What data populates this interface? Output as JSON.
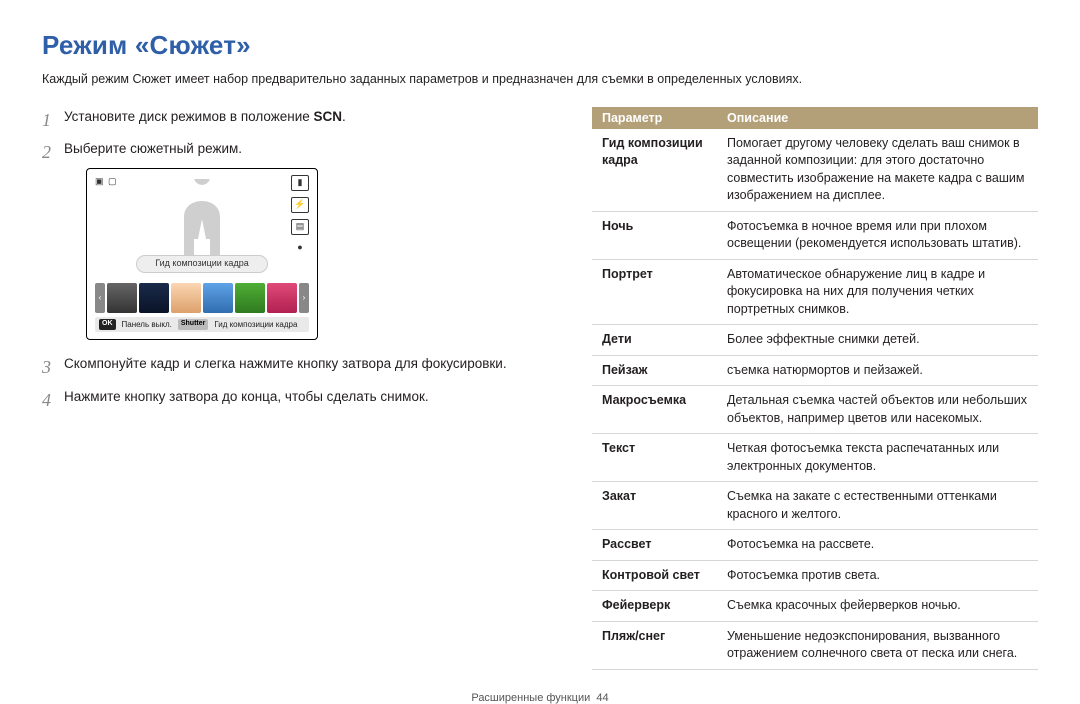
{
  "title": "Режим «Сюжет»",
  "lead": "Каждый режим Сюжет имеет набор предварительно заданных параметров и предназначен для съемки в определенных условиях.",
  "steps": {
    "s1_pre": "Установите диск режимов в положение ",
    "s1_icon": "SCN",
    "s1_post": ".",
    "s2": "Выберите сюжетный режим.",
    "s3": "Скомпонуйте кадр и слегка нажмите кнопку затвора для фокусировки.",
    "s4": "Нажмите кнопку затвора до конца, чтобы сделать снимок."
  },
  "screen": {
    "mid_label": "Гид композиции кадра",
    "ok_chip": "OK",
    "ok_text": "Панель выкл.",
    "shutter_chip": "Shutter",
    "shutter_text": "Гид композиции кадра"
  },
  "table": {
    "head_param": "Параметр",
    "head_desc": "Описание",
    "rows": [
      {
        "k": "Гид композиции кадра",
        "v": "Помогает другому человеку сделать ваш снимок в заданной композиции: для этого достаточно совместить изображение на макете кадра с вашим изображением на дисплее."
      },
      {
        "k": "Ночь",
        "v": "Фотосъемка в ночное время или при плохом освещении (рекомендуется использовать штатив)."
      },
      {
        "k": "Портрет",
        "v": "Автоматическое обнаружение лиц в кадре и фокусировка на них для получения четких портретных снимков."
      },
      {
        "k": "Дети",
        "v": "Более эффектные снимки детей."
      },
      {
        "k": "Пейзаж",
        "v": "съемка натюрмортов и пейзажей."
      },
      {
        "k": "Макросъемка",
        "v": "Детальная съемка частей объектов или небольших объектов, например цветов или насекомых."
      },
      {
        "k": "Текст",
        "v": "Четкая фотосъемка текста распечатанных или электронных документов."
      },
      {
        "k": "Закат",
        "v": "Съемка на закате с естественными оттенками красного и желтого."
      },
      {
        "k": "Рассвет",
        "v": "Фотосъемка на рассвете."
      },
      {
        "k": "Контровой свет",
        "v": "Фотосъемка против света."
      },
      {
        "k": "Фейерверк",
        "v": "Съемка красочных фейерверков ночью."
      },
      {
        "k": "Пляж/снег",
        "v": "Уменьшение недоэкспонирования, вызванного отражением солнечного света от песка или снега."
      }
    ]
  },
  "footer_label": "Расширенные функции",
  "footer_page": "44"
}
